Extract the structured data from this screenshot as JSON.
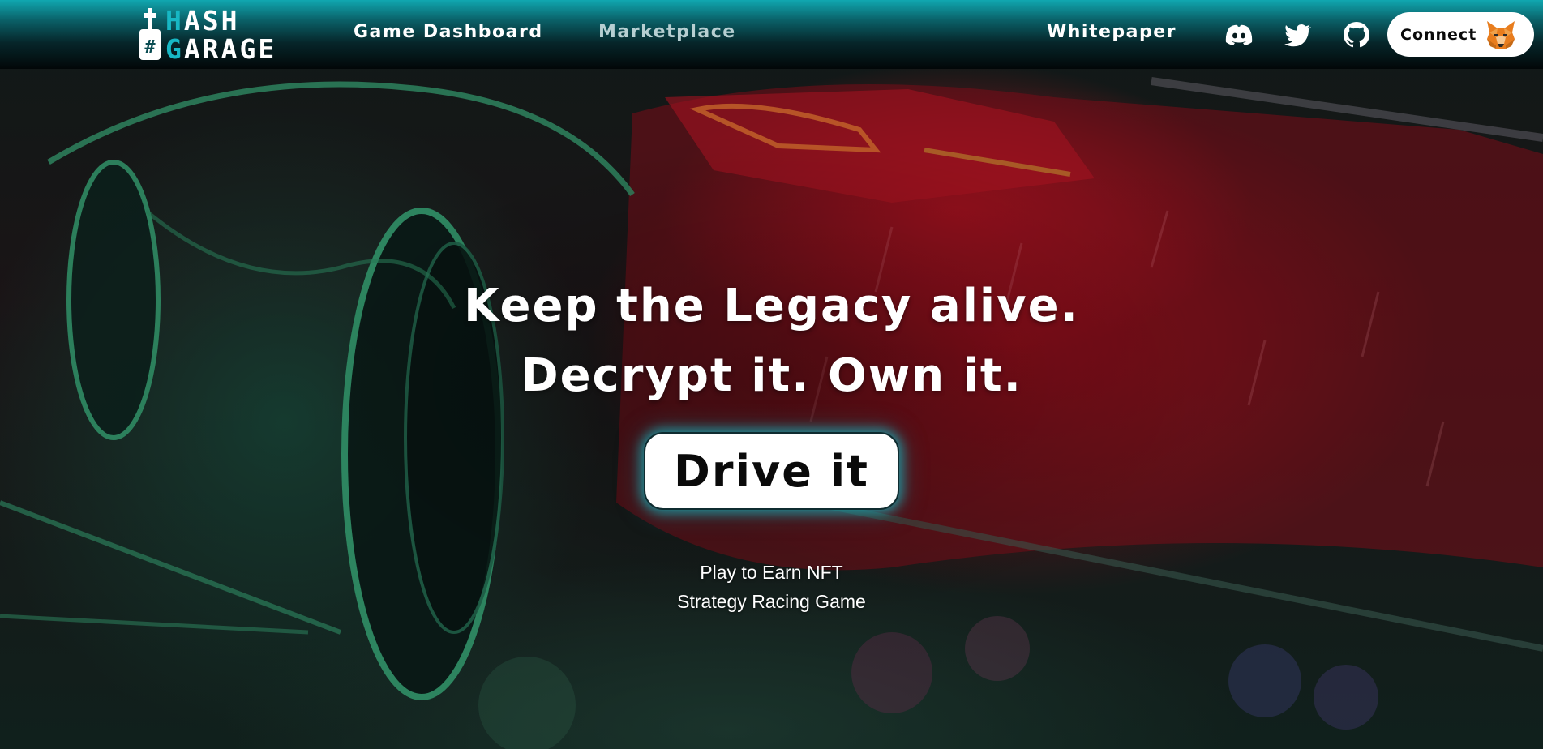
{
  "header": {
    "logo": {
      "line1_accent": "H",
      "line1_rest": "ASH",
      "line2_accent": "G",
      "line2_rest": "ARAGE"
    },
    "nav": {
      "game_dashboard": "Game Dashboard",
      "marketplace": "Marketplace",
      "whitepaper": "Whitepaper"
    },
    "social_icons": [
      "discord-icon",
      "twitter-icon",
      "github-icon"
    ],
    "connect_label": "Connect",
    "connect_icon": "metamask-fox-icon"
  },
  "hero": {
    "title_line1": "Keep the Legacy alive.",
    "title_line2": "Decrypt it. Own it.",
    "cta_label": "Drive it",
    "tagline_line1": "Play to Earn NFT",
    "tagline_line2": "Strategy Racing Game"
  },
  "colors": {
    "brand_teal": "#17b7c4",
    "header_top": "#10a7b0",
    "header_bottom": "#020708",
    "hero_red": "#b3141f",
    "hero_green": "#1f6b52"
  }
}
